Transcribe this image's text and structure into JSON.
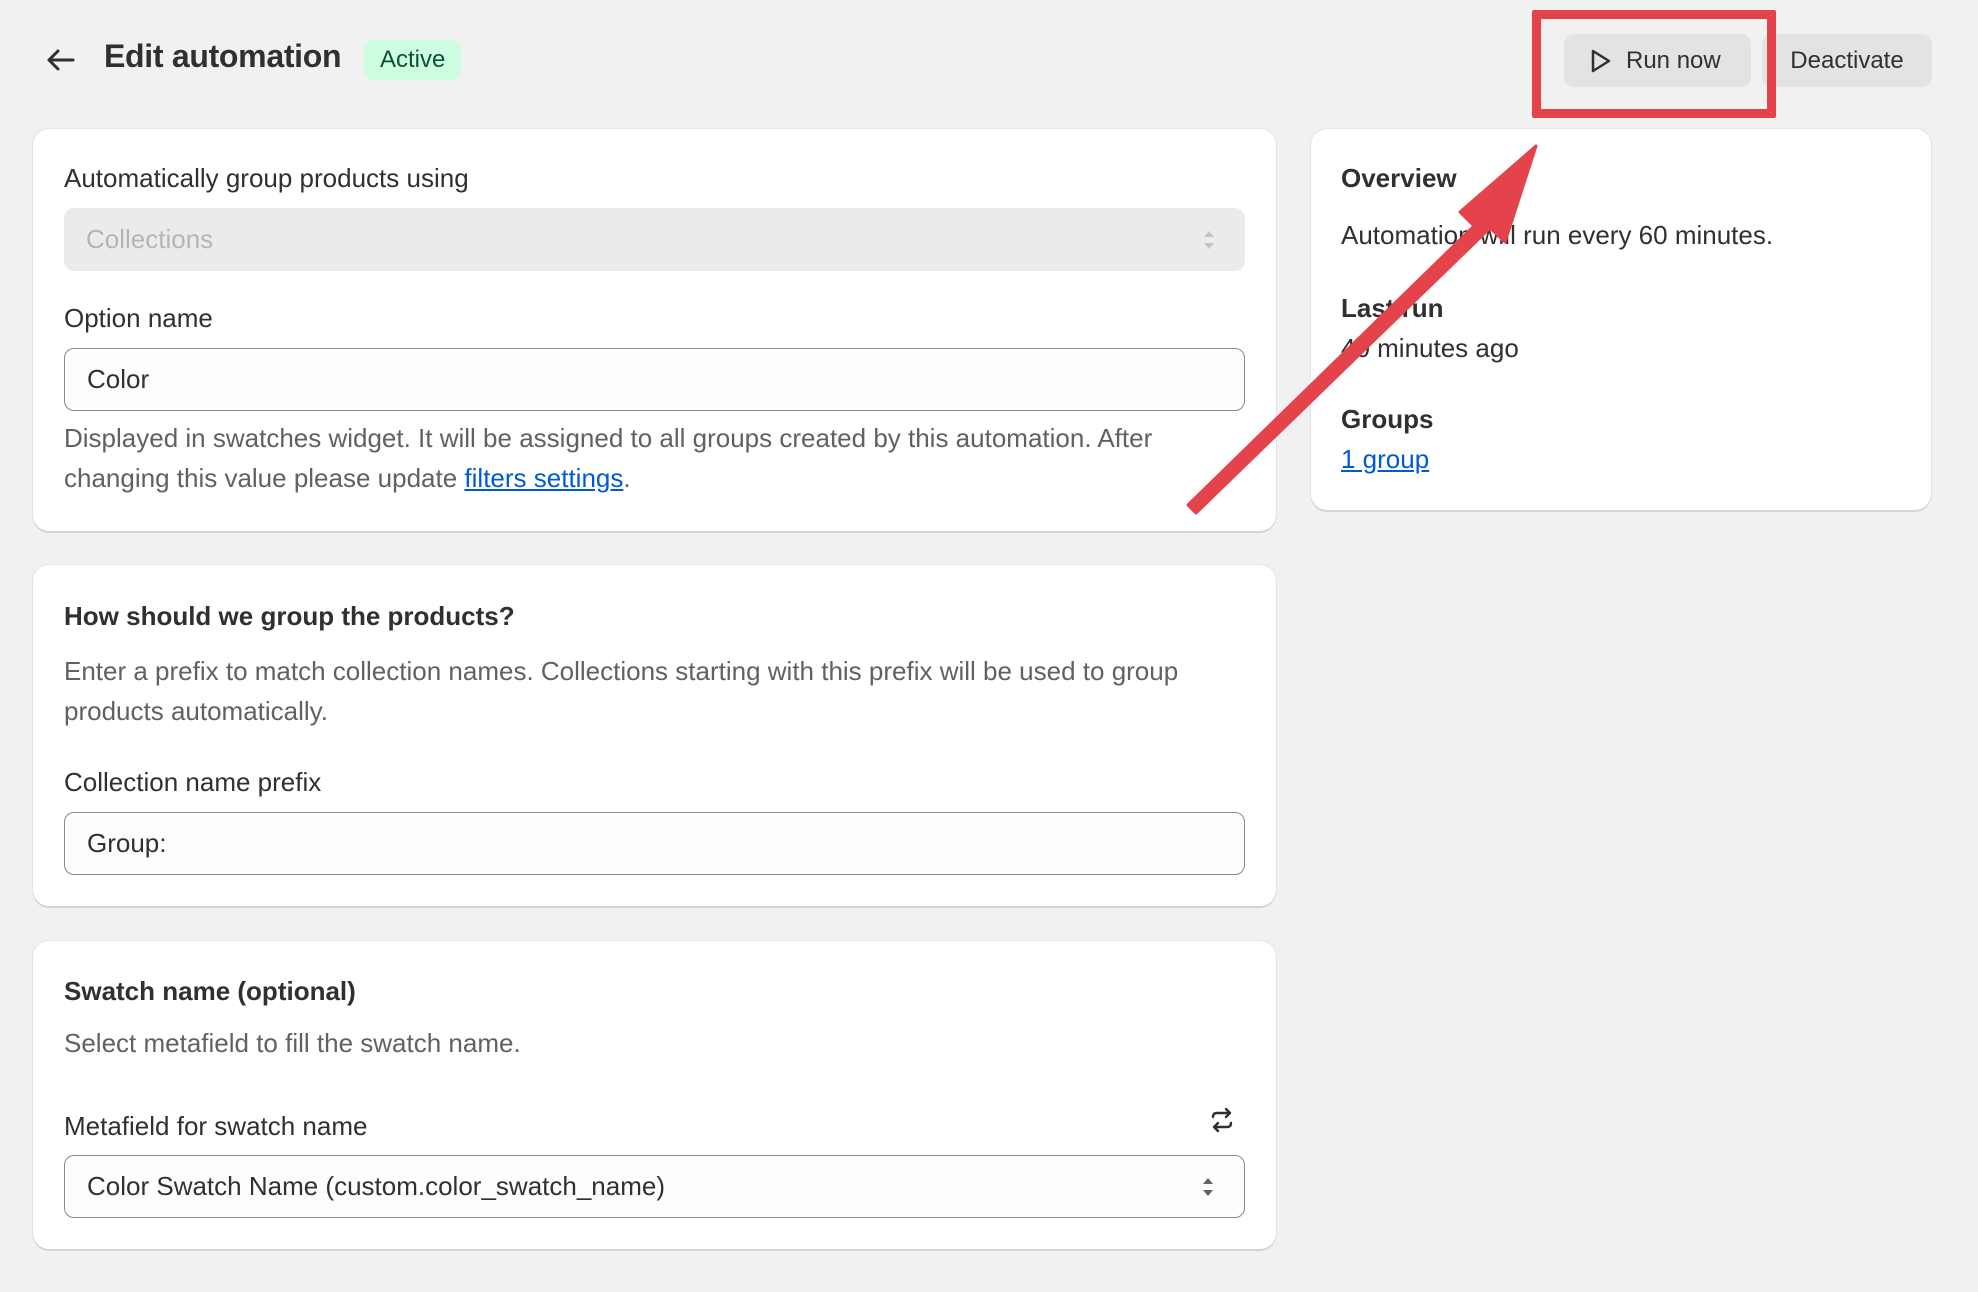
{
  "header": {
    "back_icon": "arrow-left-icon",
    "title": "Edit automation",
    "status": "Active",
    "run_now_label": "Run now",
    "run_icon": "play-icon",
    "deactivate_label": "Deactivate"
  },
  "settings_card": {
    "group_using_label": "Automatically group products using",
    "group_using_value": "Collections",
    "option_name_label": "Option name",
    "option_name_value": "Color",
    "help_text": "Displayed in swatches widget. It will be assigned to all groups created by this automation. After changing this value please update ",
    "help_link": "filters settings",
    "help_suffix": "."
  },
  "grouping_card": {
    "title": "How should we group the products?",
    "description": "Enter a prefix to match collection names. Collections starting with this prefix will be used to group products automatically.",
    "prefix_label": "Collection name prefix",
    "prefix_value": "Group:"
  },
  "swatch_card": {
    "title": "Swatch name (optional)",
    "description": "Select metafield to fill the swatch name.",
    "metafield_label": "Metafield for swatch name",
    "refresh_icon": "refresh-icon",
    "metafield_value": "Color Swatch Name (custom.color_swatch_name)"
  },
  "overview_card": {
    "title": "Overview",
    "schedule_text": "Automation will run every 60 minutes.",
    "last_run_label": "Last run",
    "last_run_value": "40 minutes ago",
    "groups_label": "Groups",
    "groups_link": "1 group"
  },
  "annotation": {
    "color": "#e5434b"
  }
}
